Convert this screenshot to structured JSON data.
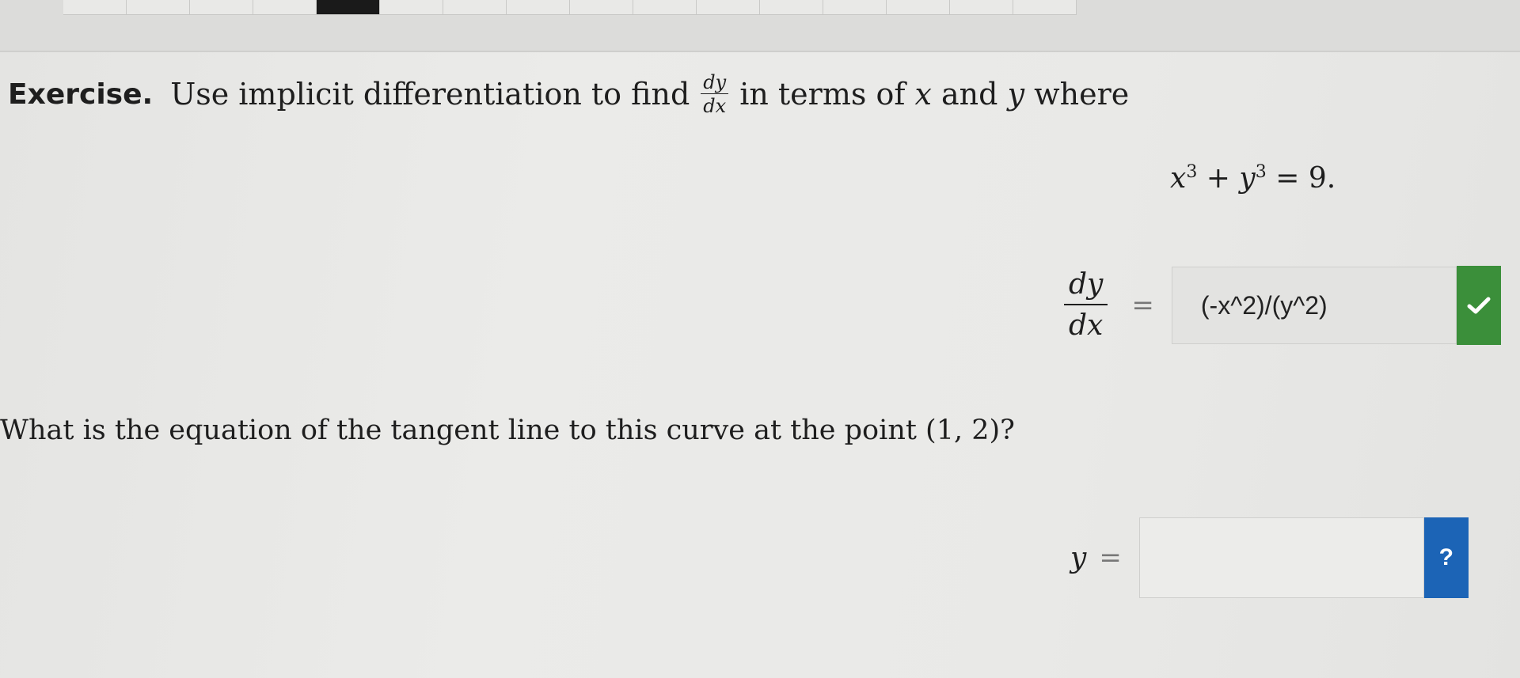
{
  "exercise": {
    "label": "Exercise.",
    "text_before": "Use implicit differentiation to find",
    "frac_num": "dy",
    "frac_den": "dx",
    "text_middle": "in terms of",
    "var_x": "x",
    "and_word": "and",
    "var_y": "y",
    "text_end": "where"
  },
  "equation": {
    "x": "x",
    "exp1": "3",
    "plus": "+",
    "y": "y",
    "exp2": "3",
    "equals": "=",
    "rhs": "9."
  },
  "derivative": {
    "num": "dy",
    "den": "dx",
    "equals": "=",
    "answer": "(-x^2)/(y^2)",
    "status_icon": "checkmark-icon",
    "status_color": "#3b8f3a"
  },
  "question": {
    "text": "What is the equation of the tangent line to this curve at the point (1, 2)?"
  },
  "tangent": {
    "label": "y",
    "equals": "=",
    "value": "",
    "placeholder": "",
    "help_label": "?",
    "help_color": "#1c64b6"
  }
}
